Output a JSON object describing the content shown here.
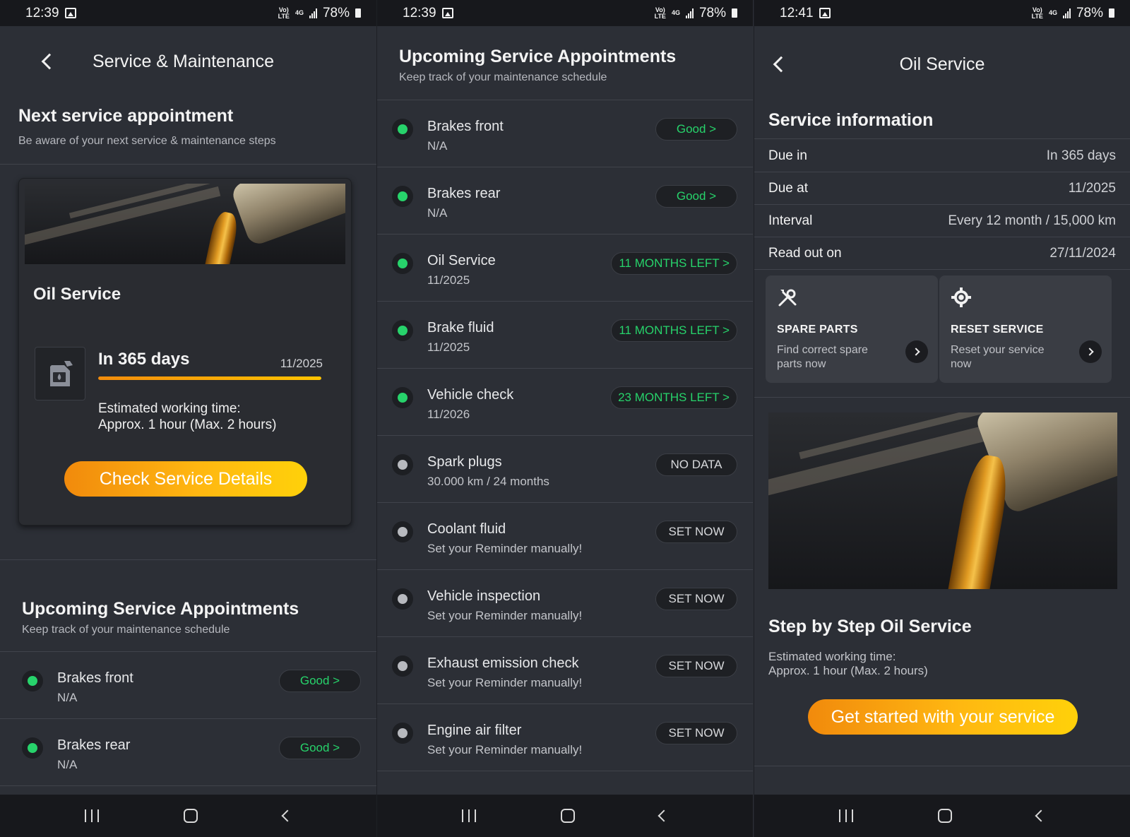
{
  "status": {
    "screen1_time": "12:39",
    "screen2_time": "12:39",
    "screen3_time": "12:41",
    "battery": "78%",
    "net_top": "Vo)",
    "net_bottom": "LTE",
    "net_4g": "4G"
  },
  "screen1": {
    "title": "Service & Maintenance",
    "next": {
      "heading": "Next service appointment",
      "subtitle": "Be aware of your next service & maintenance steps"
    },
    "card": {
      "title": "Oil Service",
      "due_in": "In 365 days",
      "due_date": "11/2025",
      "progress_fraction": 1.0,
      "est_line1": "Estimated working time:",
      "est_line2": "Approx. 1 hour (Max. 2 hours)",
      "button": "Check Service Details"
    },
    "upcoming": {
      "heading": "Upcoming Service Appointments",
      "subtitle": "Keep track of your maintenance schedule"
    },
    "items": [
      {
        "title": "Brakes front",
        "sub": "N/A",
        "badge": "Good >",
        "status": "green"
      },
      {
        "title": "Brakes rear",
        "sub": "N/A",
        "badge": "Good >",
        "status": "green"
      }
    ]
  },
  "screen2": {
    "heading": "Upcoming Service Appointments",
    "subtitle": "Keep track of your maintenance schedule",
    "items": [
      {
        "title": "Brakes front",
        "sub": "N/A",
        "badge": "Good >",
        "status": "green"
      },
      {
        "title": "Brakes rear",
        "sub": "N/A",
        "badge": "Good >",
        "status": "green"
      },
      {
        "title": "Oil Service",
        "sub": "11/2025",
        "badge": "11 MONTHS LEFT >",
        "status": "green"
      },
      {
        "title": "Brake fluid",
        "sub": "11/2025",
        "badge": "11 MONTHS LEFT >",
        "status": "green"
      },
      {
        "title": "Vehicle check",
        "sub": "11/2026",
        "badge": "23 MONTHS LEFT >",
        "status": "green"
      },
      {
        "title": "Spark plugs",
        "sub": "30.000 km / 24 months",
        "badge": "NO DATA",
        "status": "grey"
      },
      {
        "title": "Coolant fluid",
        "sub": "Set your Reminder manually!",
        "badge": "SET NOW",
        "status": "grey"
      },
      {
        "title": "Vehicle inspection",
        "sub": "Set your Reminder manually!",
        "badge": "SET NOW",
        "status": "grey"
      },
      {
        "title": "Exhaust emission check",
        "sub": "Set your Reminder manually!",
        "badge": "SET NOW",
        "status": "grey"
      },
      {
        "title": "Engine air filter",
        "sub": "Set your Reminder manually!",
        "badge": "SET NOW",
        "status": "grey"
      }
    ]
  },
  "screen3": {
    "title": "Oil Service",
    "info_heading": "Service information",
    "info": [
      {
        "key": "Due in",
        "value": "In 365 days"
      },
      {
        "key": "Due at",
        "value": "11/2025"
      },
      {
        "key": "Interval",
        "value": "Every 12 month / 15,000 km"
      },
      {
        "key": "Read out on",
        "value": "27/11/2024"
      }
    ],
    "tiles": [
      {
        "title": "SPARE PARTS",
        "text": "Find correct spare parts now",
        "icon": "wrench-screwdriver-icon"
      },
      {
        "title": "RESET SERVICE",
        "text": "Reset your service now",
        "icon": "gear-reset-icon"
      }
    ],
    "steps_heading": "Step by Step Oil Service",
    "est_line1": "Estimated working time:",
    "est_line2": "Approx. 1 hour (Max. 2 hours)",
    "button": "Get started with your service"
  },
  "colors": {
    "background": "#2c2f36",
    "status_green": "#27d36b",
    "status_grey": "#b7b9be",
    "accent_start": "#f18a0c",
    "accent_end": "#ffd10a"
  }
}
